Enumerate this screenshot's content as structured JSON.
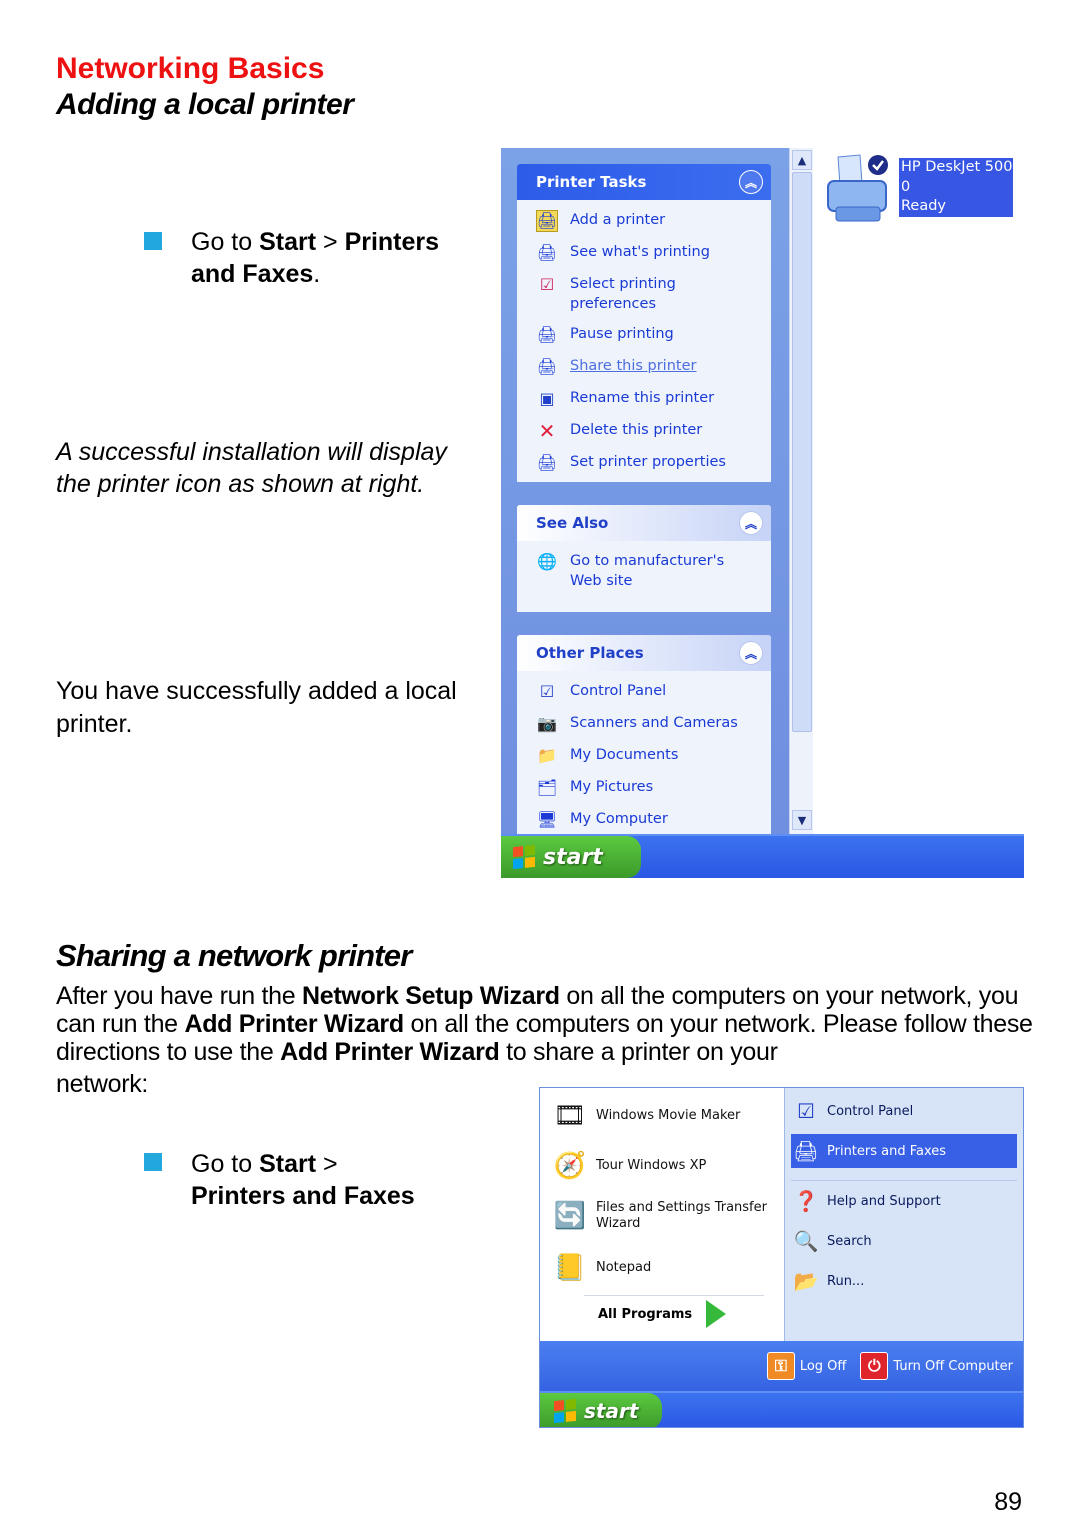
{
  "header": {
    "section_title": "Networking Basics",
    "subtitle": "Adding a local printer"
  },
  "step1": {
    "prefix": "Go to ",
    "start": "Start",
    "sep": " > ",
    "target_line1": "Printers",
    "target_line2": "and  Faxes",
    "suffix": "."
  },
  "note": "A successful installation will display the printer icon as shown at right.",
  "success": "You have successfully added a local printer.",
  "section2": {
    "title": "Sharing a network printer",
    "para": {
      "t1": "After you have run the ",
      "b1": "Network Setup Wizard",
      "t2": " on all the computers on your network, you can run the ",
      "b2": "Add Printer Wizard",
      "t3": " on all the computers on your network.  Please follow these directions to use the ",
      "b3": "Add Printer Wizard",
      "t4": " to share a printer on your",
      "t5": "network:"
    }
  },
  "step2": {
    "prefix": "Go to ",
    "start": "Start",
    "sep": " >",
    "target": "Printers and Faxes"
  },
  "screenshot1": {
    "printer_tasks": {
      "title": "Printer Tasks",
      "items": [
        {
          "label": "Add a printer",
          "icon": "add-printer-icon"
        },
        {
          "label": "See what's printing",
          "icon": "print-queue-icon"
        },
        {
          "label": "Select printing preferences",
          "icon": "preferences-icon"
        },
        {
          "label": "Pause printing",
          "icon": "pause-printing-icon"
        },
        {
          "label": "Share this printer",
          "icon": "share-printer-icon"
        },
        {
          "label": "Rename this  printer",
          "icon": "rename-icon"
        },
        {
          "label": "Delete this printer",
          "icon": "delete-icon"
        },
        {
          "label": "Set printer properties",
          "icon": "properties-icon"
        }
      ]
    },
    "see_also": {
      "title": "See Also",
      "items": [
        {
          "label": "Go to manufacturer's Web site",
          "icon": "globe-icon"
        }
      ]
    },
    "other_places": {
      "title": "Other Places",
      "items": [
        {
          "label": "Control Panel",
          "icon": "control-panel-icon"
        },
        {
          "label": "Scanners and Cameras",
          "icon": "scanner-icon"
        },
        {
          "label": "My Documents",
          "icon": "folder-icon"
        },
        {
          "label": "My Pictures",
          "icon": "pictures-folder-icon"
        },
        {
          "label": "My Computer",
          "icon": "computer-icon"
        }
      ]
    },
    "printer": {
      "name_line1": "HP DeskJet 500",
      "name_line2": "0",
      "status": "Ready"
    },
    "start_label": "start"
  },
  "screenshot2": {
    "left_items": [
      {
        "label": "Windows Movie Maker",
        "icon": "movie-maker-icon"
      },
      {
        "label": "Tour Windows XP",
        "icon": "tour-icon"
      },
      {
        "label": "Files and Settings Transfer Wizard",
        "icon": "transfer-wizard-icon"
      },
      {
        "label": "Notepad",
        "icon": "notepad-icon"
      }
    ],
    "all_programs": "All Programs",
    "right_items": [
      {
        "label": "Control Panel",
        "icon": "control-panel-icon"
      },
      {
        "label": "Printers and Faxes",
        "icon": "printer-icon",
        "selected": true
      },
      {
        "label": "Help and Support",
        "icon": "help-icon"
      },
      {
        "label": "Search",
        "icon": "search-icon"
      },
      {
        "label": "Run...",
        "icon": "run-icon"
      }
    ],
    "log_off": "Log Off",
    "turn_off": "Turn Off Computer",
    "start_label": "start"
  },
  "page_number": "89",
  "colors": {
    "heading_red": "#ee1111",
    "bullet_blue": "#22a8dc",
    "xp_blue": "#3756e4",
    "xp_green": "#3b9a2a"
  }
}
